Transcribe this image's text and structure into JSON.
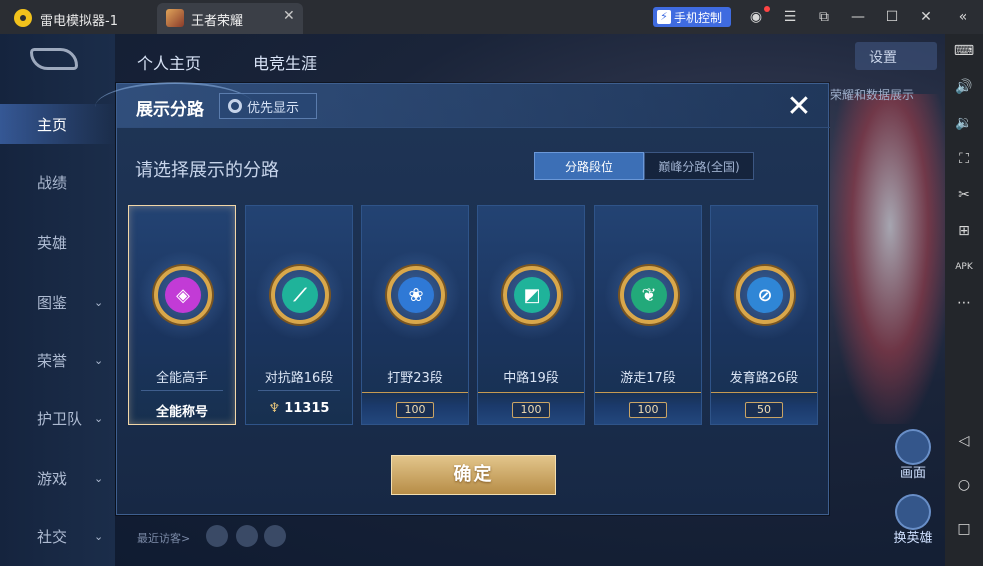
{
  "titlebar": {
    "app_title": "雷电模拟器-1",
    "tab_label": "王者荣耀",
    "tab_close": "✕",
    "phone_control": "手机控制",
    "phone_control_icon": "⚡",
    "buttons": [
      "user-icon",
      "menu-icon",
      "screenshot-icon",
      "minimize-icon",
      "maximize-icon",
      "close-icon",
      "collapse-icon"
    ]
  },
  "sidebar": {
    "icons": [
      "keyboard-icon",
      "volume-up-icon",
      "volume-down-icon",
      "fullscreen-icon",
      "scissors-icon",
      "add-icon",
      "apk-icon",
      "more-icon",
      "back-icon",
      "home-icon",
      "recent-icon"
    ]
  },
  "game": {
    "top_tabs": [
      "个人主页",
      "电竞生涯"
    ],
    "settings": "设置",
    "right_text": "荣耀和数据展示",
    "nav": [
      {
        "label": "主页",
        "active": true,
        "chevron": false
      },
      {
        "label": "战绩",
        "active": false,
        "chevron": false
      },
      {
        "label": "英雄",
        "active": false,
        "chevron": false
      },
      {
        "label": "图鉴",
        "active": false,
        "chevron": true
      },
      {
        "label": "荣誉",
        "active": false,
        "chevron": true
      },
      {
        "label": "护卫队",
        "active": false,
        "chevron": true
      },
      {
        "label": "游戏",
        "active": false,
        "chevron": true
      },
      {
        "label": "社交",
        "active": false,
        "chevron": true
      }
    ],
    "recent_visitors": "最近访客>",
    "bottom_right": [
      "画面",
      "换英雄"
    ]
  },
  "modal": {
    "title": "展示分路",
    "priority_button": "优先显示",
    "close": "✕",
    "prompt": "请选择展示的分路",
    "segments": [
      "分路段位",
      "巅峰分路(全国)"
    ],
    "cards": [
      {
        "label": "全能高手",
        "sub": "全能称号",
        "sub_type": "text",
        "selected": true,
        "color": "#c23bd6",
        "glyph": "◈"
      },
      {
        "label": "对抗路16段",
        "sub": "11315",
        "sub_type": "score",
        "selected": false,
        "color": "#1fb39a",
        "glyph": "⟋"
      },
      {
        "label": "打野23段",
        "sub": "100",
        "sub_type": "ribbon",
        "selected": false,
        "color": "#2f79d6",
        "glyph": "❀"
      },
      {
        "label": "中路19段",
        "sub": "100",
        "sub_type": "ribbon",
        "selected": false,
        "color": "#1fb39a",
        "glyph": "◩"
      },
      {
        "label": "游走17段",
        "sub": "100",
        "sub_type": "ribbon",
        "selected": false,
        "color": "#22a97a",
        "glyph": "❦"
      },
      {
        "label": "发育路26段",
        "sub": "50",
        "sub_type": "ribbon",
        "selected": false,
        "color": "#2f86d6",
        "glyph": "⊘"
      }
    ],
    "confirm": "确定"
  }
}
